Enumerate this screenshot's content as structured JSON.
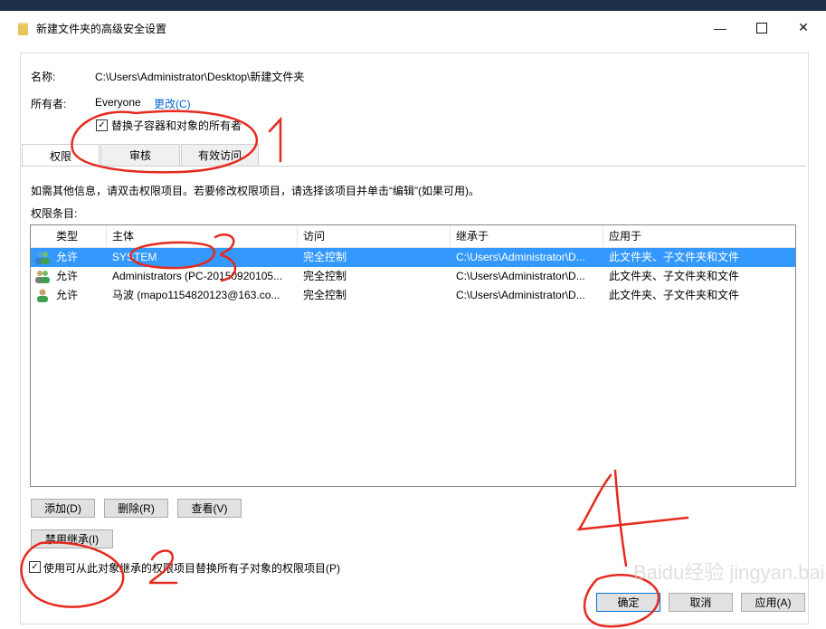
{
  "window": {
    "title": "新建文件夹的高级安全设置",
    "controls": {
      "minimize": "—",
      "maximize": "□",
      "close": "✕"
    }
  },
  "info": {
    "name_label": "名称:",
    "name_value": "C:\\Users\\Administrator\\Desktop\\新建文件夹",
    "owner_label": "所有者:",
    "owner_value": "Everyone",
    "owner_change_link": "更改(C)",
    "replace_owner_checkbox": {
      "label": "替换子容器和对象的所有者",
      "checked": true
    }
  },
  "tabs": [
    {
      "label": "权限",
      "active": true
    },
    {
      "label": "审核",
      "active": false
    },
    {
      "label": "有效访问",
      "active": false
    }
  ],
  "instructions": "如需其他信息，请双击权限项目。若要修改权限项目，请选择该项目并单击“编辑”(如果可用)。",
  "entries_label": "权限条目:",
  "grid": {
    "columns": [
      "类型",
      "主体",
      "访问",
      "继承于",
      "应用于"
    ],
    "rows": [
      {
        "type": "允许",
        "principal": "SYSTEM",
        "access": "完全控制",
        "inherited_from": "C:\\Users\\Administrator\\D...",
        "applies_to": "此文件夹、子文件夹和文件",
        "selected": true,
        "icon": "users-group-icon"
      },
      {
        "type": "允许",
        "principal": "Administrators (PC-20150920105...",
        "access": "完全控制",
        "inherited_from": "C:\\Users\\Administrator\\D...",
        "applies_to": "此文件夹、子文件夹和文件",
        "selected": false,
        "icon": "users-group-icon"
      },
      {
        "type": "允许",
        "principal": "马波 (mapo1154820123@163.co...",
        "access": "完全控制",
        "inherited_from": "C:\\Users\\Administrator\\D...",
        "applies_to": "此文件夹、子文件夹和文件",
        "selected": false,
        "icon": "user-icon"
      }
    ]
  },
  "buttons": {
    "add": "添加(D)",
    "remove": "删除(R)",
    "view": "查看(V)",
    "disable_inheritance": "禁用继承(I)",
    "ok": "确定",
    "cancel": "取消",
    "apply": "应用(A)"
  },
  "replace_child_checkbox": {
    "label": "使用可从此对象继承的权限项目替换所有子对象的权限项目(P)",
    "checked": true
  },
  "annotations": {
    "num1": "1",
    "num2": "2",
    "num3": "3",
    "num4": "4",
    "color": "#e52a1f"
  },
  "watermark": "Baidu经验 jingyan.baidu.com"
}
